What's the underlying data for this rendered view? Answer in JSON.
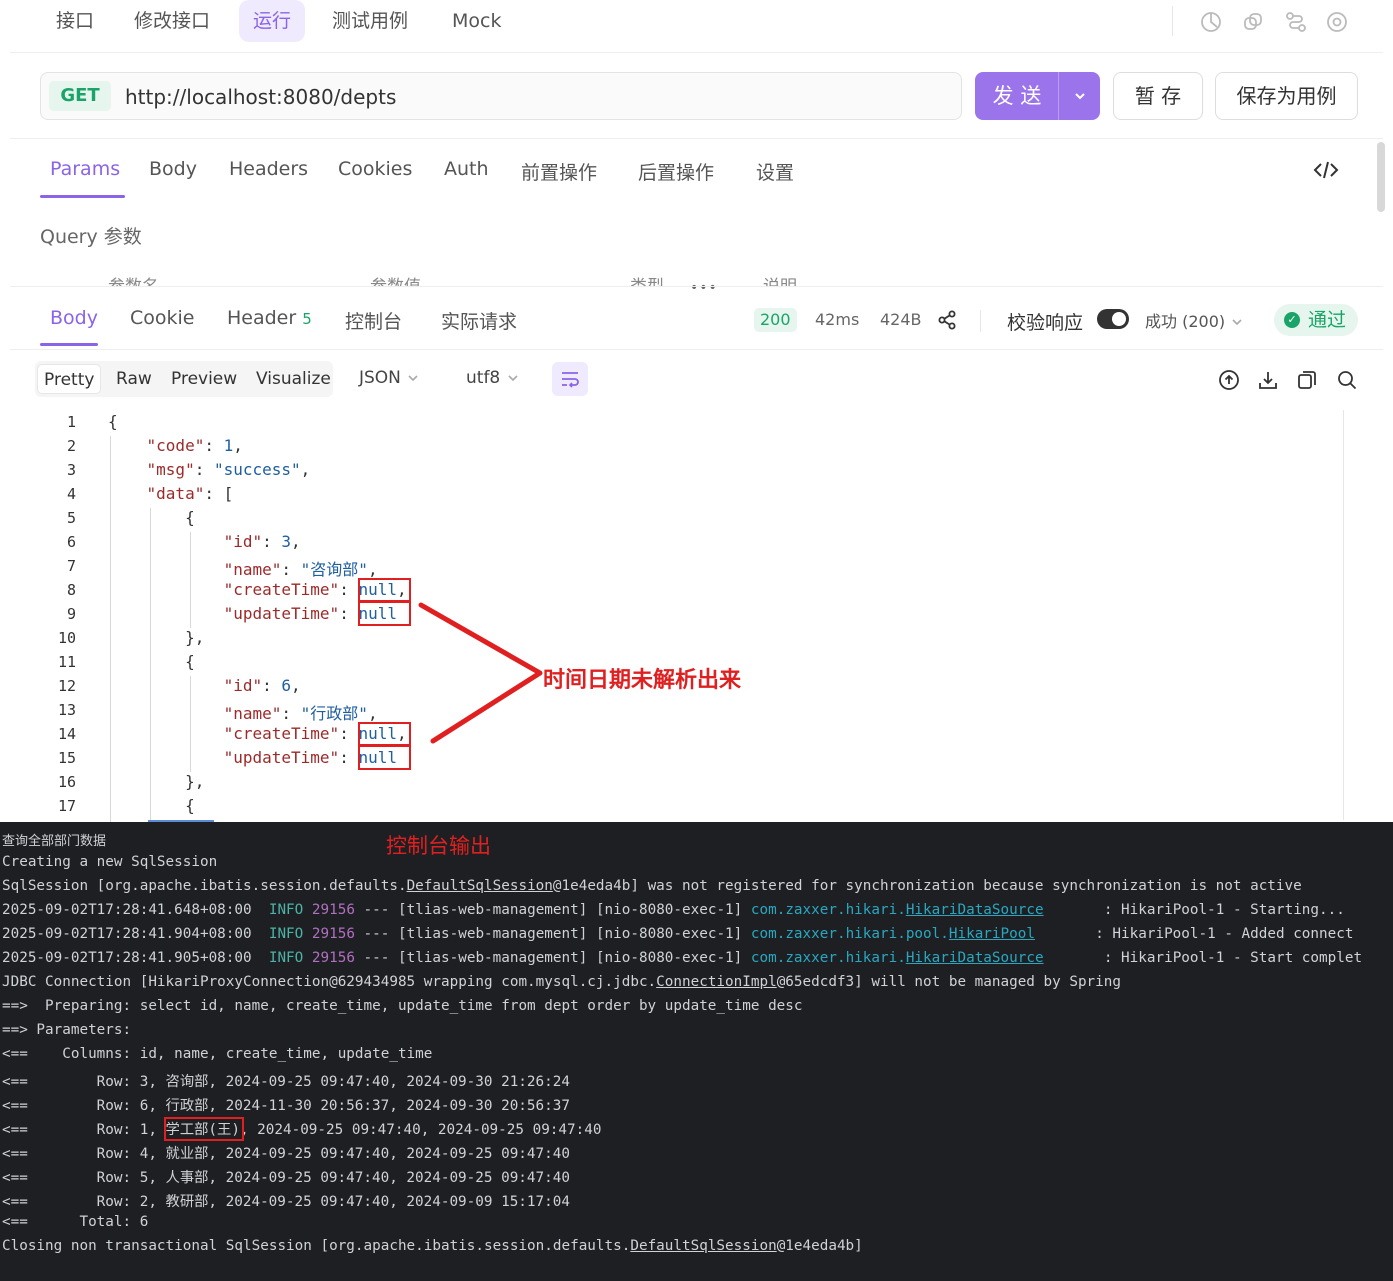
{
  "top_tabs": [
    "接口",
    "修改接口",
    "运行",
    "测试用例",
    "Mock"
  ],
  "request": {
    "method": "GET",
    "url": "http://localhost:8080/depts",
    "send_label": "发 送",
    "save_label": "暂 存",
    "save_case_label": "保存为用例"
  },
  "request_tabs": [
    "Params",
    "Body",
    "Headers",
    "Cookies",
    "Auth",
    "前置操作",
    "后置操作",
    "设置"
  ],
  "query_label": "Query 参数",
  "param_headers": [
    "参数名",
    "参数值",
    "类型",
    "说明"
  ],
  "response": {
    "tabs": [
      "Body",
      "Cookie",
      "Header",
      "控制台",
      "实际请求"
    ],
    "header_count": "5",
    "status_code": "200",
    "time": "42ms",
    "size": "424B",
    "validate_label": "校验响应",
    "success_select": "成功 (200)",
    "pass_label": "通过",
    "view_modes": [
      "Pretty",
      "Raw",
      "Preview",
      "Visualize"
    ],
    "format": "JSON",
    "encoding": "utf8"
  },
  "code": {
    "line_numbers": [
      "1",
      "2",
      "3",
      "4",
      "5",
      "6",
      "7",
      "8",
      "9",
      "10",
      "11",
      "12",
      "13",
      "14",
      "15",
      "16",
      "17"
    ],
    "l1": "{",
    "k_code": "\"code\"",
    "v_code": "1",
    "k_msg": "\"msg\"",
    "v_msg": "\"success\"",
    "k_data": "\"data\"",
    "k_id": "\"id\"",
    "v_id1": "3",
    "v_id2": "6",
    "k_name": "\"name\"",
    "v_name1": "\"咨询部\"",
    "v_name2": "\"行政部\"",
    "k_create": "\"createTime\"",
    "k_update": "\"updateTime\"",
    "v_null": "null"
  },
  "annotation": "时间日期未解析出来",
  "console": {
    "title": "控制台输出",
    "line1": "查询全部部门数据",
    "line2": "Creating a new SqlSession",
    "line3a": "SqlSession [org.apache.ibatis.session.defaults.",
    "line3b": "DefaultSqlSession",
    "line3c": "@1e4eda4b] was not registered for synchronization because synchronization is not active",
    "log": [
      {
        "ts": "2025-09-02T17:28:41.648+08:00",
        "level": "INFO",
        "pid": "29156",
        "mid": " --- [tlias-web-management] [nio-8080-exec-1] ",
        "cls1": "com.zaxxer.hikari.",
        "cls2": "HikariDataSource",
        "pad": "       ",
        "msg": ": HikariPool-1 - Starting..."
      },
      {
        "ts": "2025-09-02T17:28:41.904+08:00",
        "level": "INFO",
        "pid": "29156",
        "mid": " --- [tlias-web-management] [nio-8080-exec-1] ",
        "cls1": "com.zaxxer.hikari.pool.",
        "cls2": "HikariPool",
        "pad": "       ",
        "msg": ": HikariPool-1 - Added connect"
      },
      {
        "ts": "2025-09-02T17:28:41.905+08:00",
        "level": "INFO",
        "pid": "29156",
        "mid": " --- [tlias-web-management] [nio-8080-exec-1] ",
        "cls1": "com.zaxxer.hikari.",
        "cls2": "HikariDataSource",
        "pad": "       ",
        "msg": ": HikariPool-1 - Start complet"
      }
    ],
    "jdbc_a": "JDBC Connection [HikariProxyConnection@629434985 wrapping com.mysql.cj.jdbc.",
    "jdbc_b": "ConnectionImpl",
    "jdbc_c": "@65edcdf3] will not be managed by Spring",
    "preparing": "==>  Preparing: select id, name, create_time, update_time from dept order by update_time desc",
    "parameters": "==> Parameters: ",
    "columns": "<==    Columns: id, name, create_time, update_time",
    "rows": [
      "<==        Row: 3, 咨询部, 2024-09-25 09:47:40, 2024-09-30 21:26:24",
      "<==        Row: 6, 行政部, 2024-11-30 20:56:37, 2024-09-30 20:56:37",
      "<==        Row: 1, 学工部(王), 2024-09-25 09:47:40, 2024-09-25 09:47:40",
      "<==        Row: 4, 就业部, 2024-09-25 09:47:40, 2024-09-25 09:47:40",
      "<==        Row: 5, 人事部, 2024-09-25 09:47:40, 2024-09-25 09:47:40",
      "<==        Row: 2, 教研部, 2024-09-25 09:47:40, 2024-09-09 15:17:04"
    ],
    "total": "<==      Total: 6",
    "closing_a": "Closing non transactional SqlSession [org.apache.ibatis.session.defaults.",
    "closing_b": "DefaultSqlSession",
    "closing_c": "@1e4eda4b]"
  },
  "colors": {
    "accent": "#8a64e8",
    "success": "#1aa468",
    "annotation": "#e02020",
    "console_bg": "#1e1f22"
  }
}
